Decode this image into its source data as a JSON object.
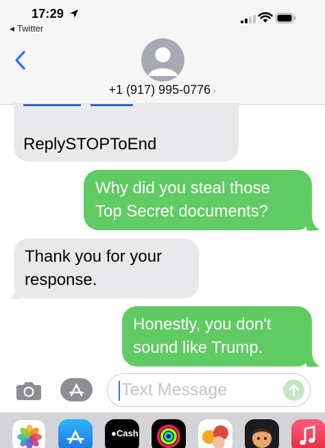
{
  "status_bar": {
    "time": "17:29",
    "back_app": "Twitter"
  },
  "header": {
    "contact": "+1 (917) 995-0776",
    "chevron": "›"
  },
  "messages": [
    {
      "direction": "incoming",
      "line1": "ReplySTOPToEnd",
      "line2": ""
    },
    {
      "direction": "outgoing",
      "line1": "Why did you steal those",
      "line2": "Top Secret documents?"
    },
    {
      "direction": "incoming",
      "line1": "Thank you for your",
      "line2": "response."
    },
    {
      "direction": "outgoing",
      "line1": "Honestly, you don't",
      "line2": "sound like Trump."
    }
  ],
  "input": {
    "placeholder": "Text Message"
  },
  "app_drawer": {
    "apps": [
      {
        "name": "Photos",
        "icon": "photos-icon"
      },
      {
        "name": "App Store",
        "icon": "app-store-icon"
      },
      {
        "name": "Cash",
        "label": "Cash",
        "icon": "apple-cash-icon"
      },
      {
        "name": "Activity",
        "icon": "activity-rings-icon"
      },
      {
        "name": "Animoji",
        "icon": "animoji-icon"
      },
      {
        "name": "Memoji",
        "icon": "memoji-icon"
      },
      {
        "name": "Music",
        "icon": "music-icon"
      }
    ]
  },
  "colors": {
    "outgoing_bubble": "#5fcb62",
    "incoming_bubble": "#e9e9eb",
    "accent": "#2d6ff5"
  }
}
